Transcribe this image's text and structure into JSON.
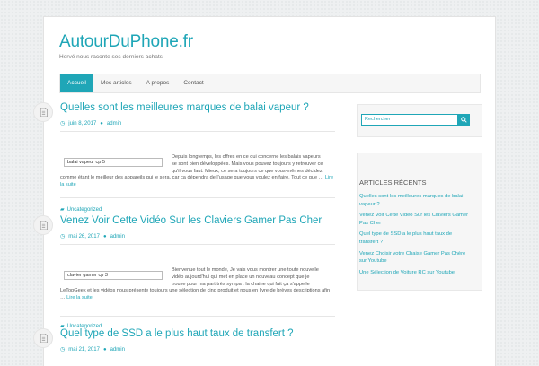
{
  "site": {
    "title": "AutourDuPhone.fr",
    "tagline": "Hervé nous raconte ses derniers achats"
  },
  "nav": [
    "Accueil",
    "Mes articles",
    "A propos",
    "Contact"
  ],
  "posts": [
    {
      "title": "Quelles sont les meilleures marques de balai vapeur ?",
      "date": "juin 8, 2017",
      "author": "admin",
      "search_value": "balai vapeur cp 5",
      "excerpt_lines": [
        "Depuis longtemps, les offres en ce qui concerne les balais vapeurs",
        "se sont bien développées. Mais vous pouvez toujours y retrouver ce",
        "qu'il vous faut. Mieux, ce sera toujours ce que vous-mêmes décidez"
      ],
      "excerpt_full": "comme étant le meilleur des appareils qui le sera, car ça dépendra de l'usage que vous voulez en faire. Tout ce que",
      "excerpt_tail": "…",
      "more": "Lire la suite",
      "category": "Uncategorized"
    },
    {
      "title": "Venez Voir Cette Vidéo Sur les Claviers Gamer Pas Cher",
      "date": "mai 26, 2017",
      "author": "admin",
      "search_value": "clavier gamer cp 3",
      "excerpt_lines": [
        "Bienvenue tout le monde, Je vais vous montrer une toute nouvelle",
        "vidéo aujourd'hui qui met en place un nouveau concept que je",
        "trouve pour ma part très sympa : la chaine qui fait ça s'appelle"
      ],
      "excerpt_full": "LeTopGeek et les vidéos nous présente toujours une sélection de cinq produit et nous en livre de brèves",
      "excerpt_tail": "descriptions afin …",
      "more": "Lire la suite",
      "category": "Uncategorized"
    },
    {
      "title": "Quel type de SSD a le plus haut taux de transfert ?",
      "date": "mai 21, 2017",
      "author": "admin"
    }
  ],
  "sidebar": {
    "search_placeholder": "Rechercher",
    "recent_title": "ARTICLES RÉCENTS",
    "recent": [
      "Quelles sont les meilleures marques de balai vapeur ?",
      "Venez Voir Cette Vidéo Sur les Claviers Gamer Pas Cher",
      "Quel type de SSD a le plus haut taux de transfert ?",
      "Venez Choisir votre Chaise Gamer Pas Chère sur Youtube",
      "Une Sélection de Voiture RC sur Youtube"
    ]
  },
  "colors": {
    "accent": "#1fa6b7"
  }
}
